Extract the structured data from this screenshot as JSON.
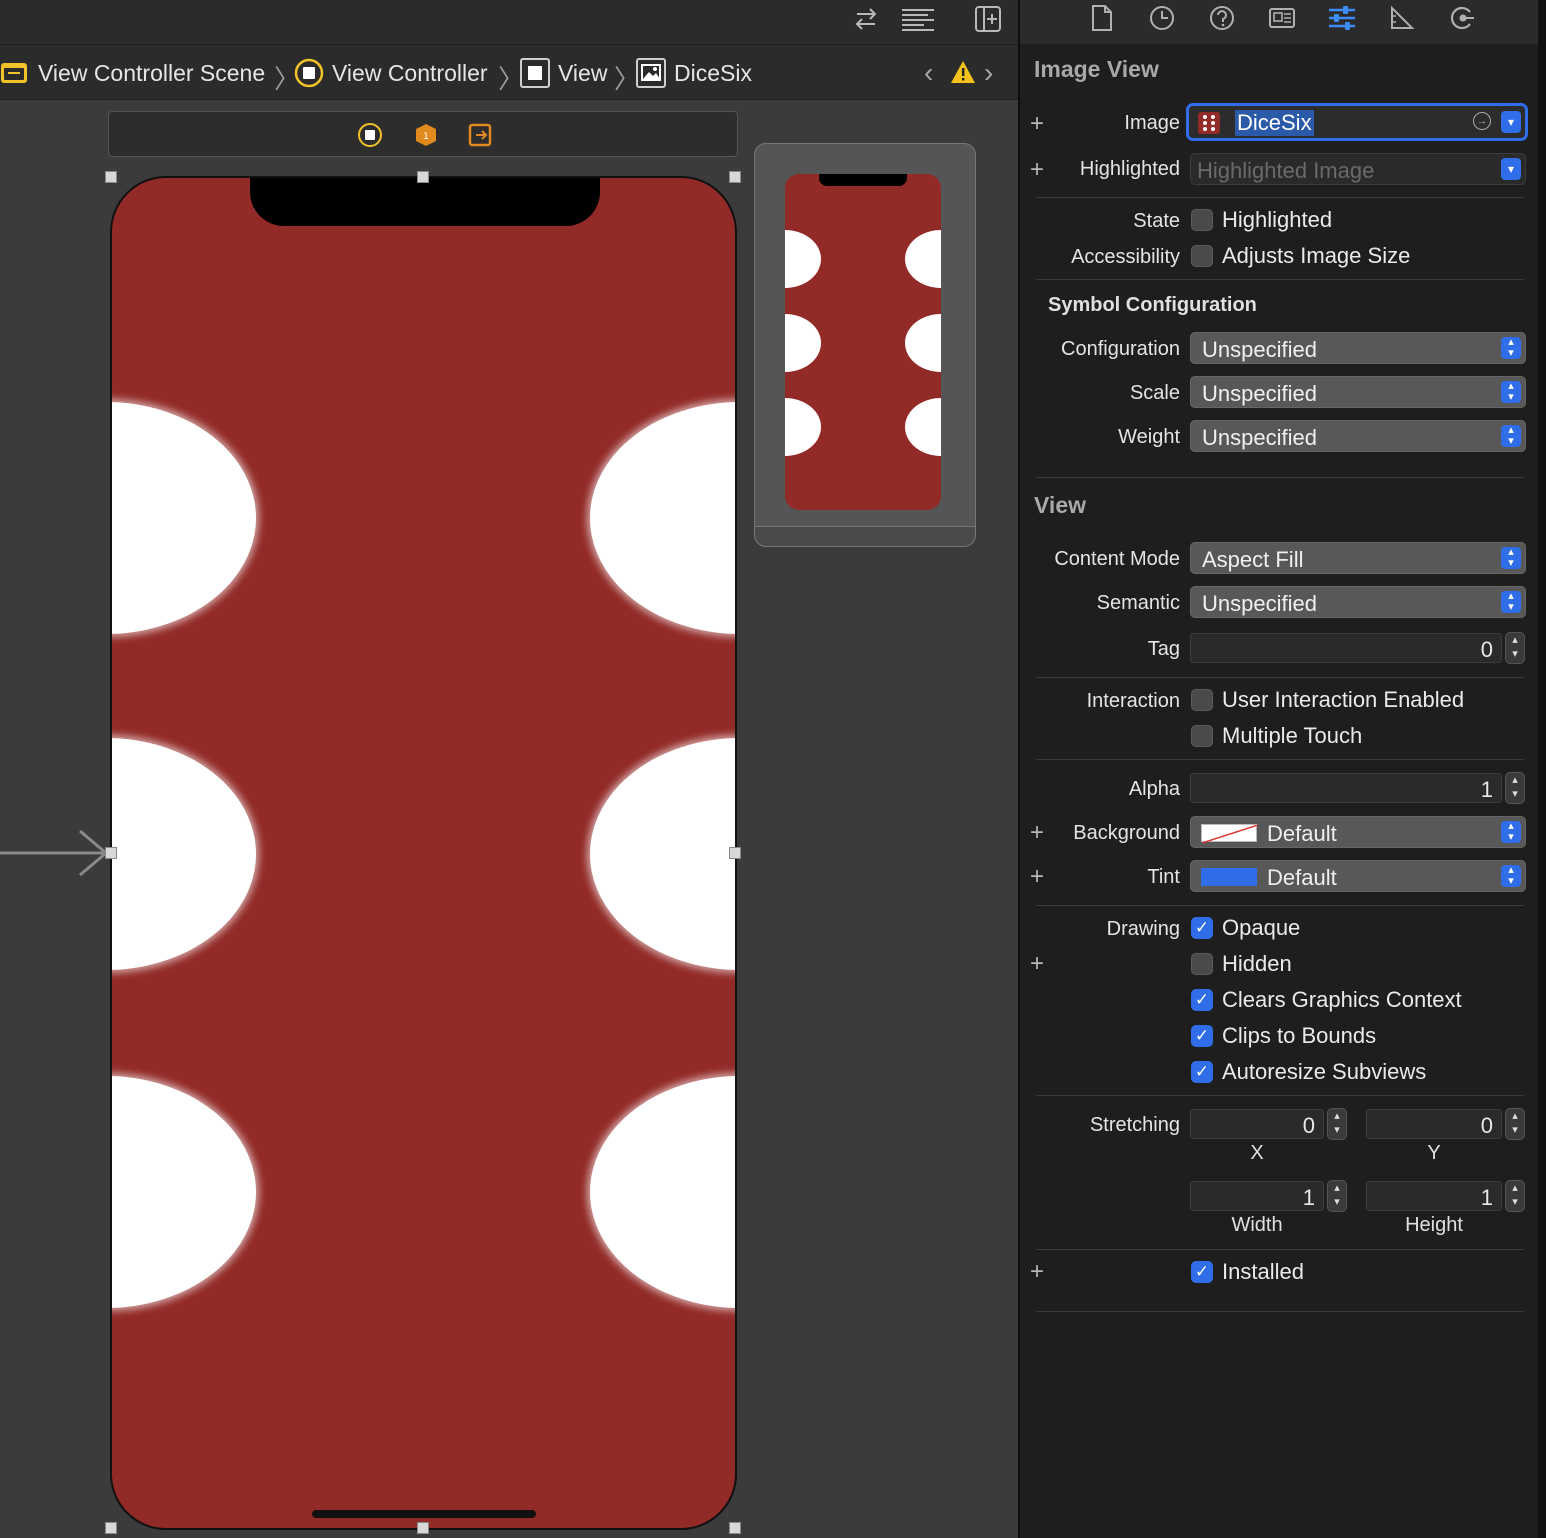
{
  "toolbar": {
    "icons": [
      "swap-arrows-icon",
      "align-lines-icon",
      "add-editor-icon"
    ]
  },
  "jumpbar": {
    "crumbs": [
      {
        "label": "View Controller Scene",
        "icon": "scene-icon"
      },
      {
        "label": "View Controller",
        "icon": "view-controller-icon"
      },
      {
        "label": "View",
        "icon": "view-icon"
      },
      {
        "label": "DiceSix",
        "icon": "image-view-icon"
      }
    ],
    "separator": "〉",
    "prev": "‹",
    "next": "›",
    "warning_color": "#f4c21a"
  },
  "canvas": {
    "device_color": "#922a27",
    "dot_color": "#ffffff"
  },
  "inspector": {
    "tabs": [
      "file-icon",
      "history-icon",
      "help-icon",
      "identity-icon",
      "attributes-icon",
      "size-icon",
      "connections-icon"
    ],
    "active_tab": "attributes-icon",
    "image_view": {
      "title": "Image View",
      "image_label": "Image",
      "image_value": "DiceSix",
      "highlighted_label": "Highlighted",
      "highlighted_placeholder": "Highlighted Image",
      "state_label": "State",
      "state_option": "Highlighted",
      "accessibility_label": "Accessibility",
      "accessibility_option": "Adjusts Image Size"
    },
    "symbol_config": {
      "title": "Symbol Configuration",
      "configuration_label": "Configuration",
      "configuration_value": "Unspecified",
      "scale_label": "Scale",
      "scale_value": "Unspecified",
      "weight_label": "Weight",
      "weight_value": "Unspecified"
    },
    "view": {
      "title": "View",
      "content_mode_label": "Content Mode",
      "content_mode_value": "Aspect Fill",
      "semantic_label": "Semantic",
      "semantic_value": "Unspecified",
      "tag_label": "Tag",
      "tag_value": "0",
      "interaction_label": "Interaction",
      "user_interaction": "User Interaction Enabled",
      "multiple_touch": "Multiple Touch",
      "alpha_label": "Alpha",
      "alpha_value": "1",
      "background_label": "Background",
      "background_value": "Default",
      "tint_label": "Tint",
      "tint_value": "Default",
      "tint_color": "#2f6ee8",
      "drawing_label": "Drawing",
      "opaque": "Opaque",
      "hidden": "Hidden",
      "clears_graphics": "Clears Graphics Context",
      "clips_to_bounds": "Clips to Bounds",
      "autoresize": "Autoresize Subviews",
      "stretching_label": "Stretching",
      "stretch_x": "0",
      "stretch_y": "0",
      "stretch_width": "1",
      "stretch_height": "1",
      "x_caption": "X",
      "y_caption": "Y",
      "width_caption": "Width",
      "height_caption": "Height",
      "installed": "Installed"
    },
    "checked": {
      "state_highlighted": false,
      "adjusts_image_size": false,
      "user_interaction_enabled": false,
      "multiple_touch": false,
      "opaque": true,
      "hidden": false,
      "clears_graphics_context": true,
      "clips_to_bounds": true,
      "autoresize_subviews": true,
      "installed": true
    },
    "accent_color": "#2f6ee8"
  }
}
